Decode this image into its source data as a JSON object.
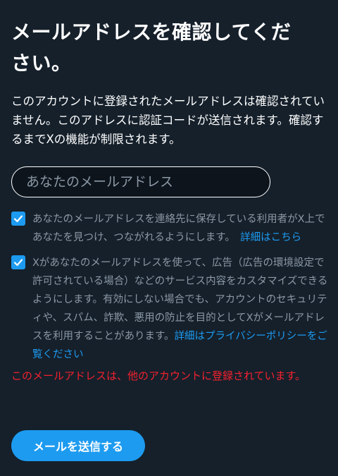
{
  "title": "メールアドレスを確認してください。",
  "description": "このアカウントに登録されたメールアドレスは確認されていません。このアドレスに認証コードが送信されます。確認するまでXの機能が制限されます。",
  "email_input": {
    "value": "",
    "placeholder": "あなたのメールアドレス"
  },
  "checkboxes": [
    {
      "checked": true,
      "text": "あなたのメールアドレスを連絡先に保存している利用者がX上であなたを見つけ、つながれるようにします。",
      "link": "詳細はこちら"
    },
    {
      "checked": true,
      "text": "Xがあなたのメールアドレスを使って、広告（広告の環境設定で許可されている場合）などのサービス内容をカスタマイズできるようにします。有効にしない場合でも、アカウントのセキュリティや、スパム、詐欺、悪用の防止を目的としてXがメールアドレスを利用することがあります。",
      "link": "詳細はプライバシーポリシーをご覧ください"
    }
  ],
  "error_message": "このメールアドレスは、他のアカウントに登録されています。",
  "send_button_label": "メールを送信する",
  "colors": {
    "background": "#15202b",
    "accent": "#1d9bf0",
    "muted_text": "#8b98a5",
    "error": "#f4212e"
  },
  "icons": {
    "checkbox": "checkmark-icon"
  }
}
